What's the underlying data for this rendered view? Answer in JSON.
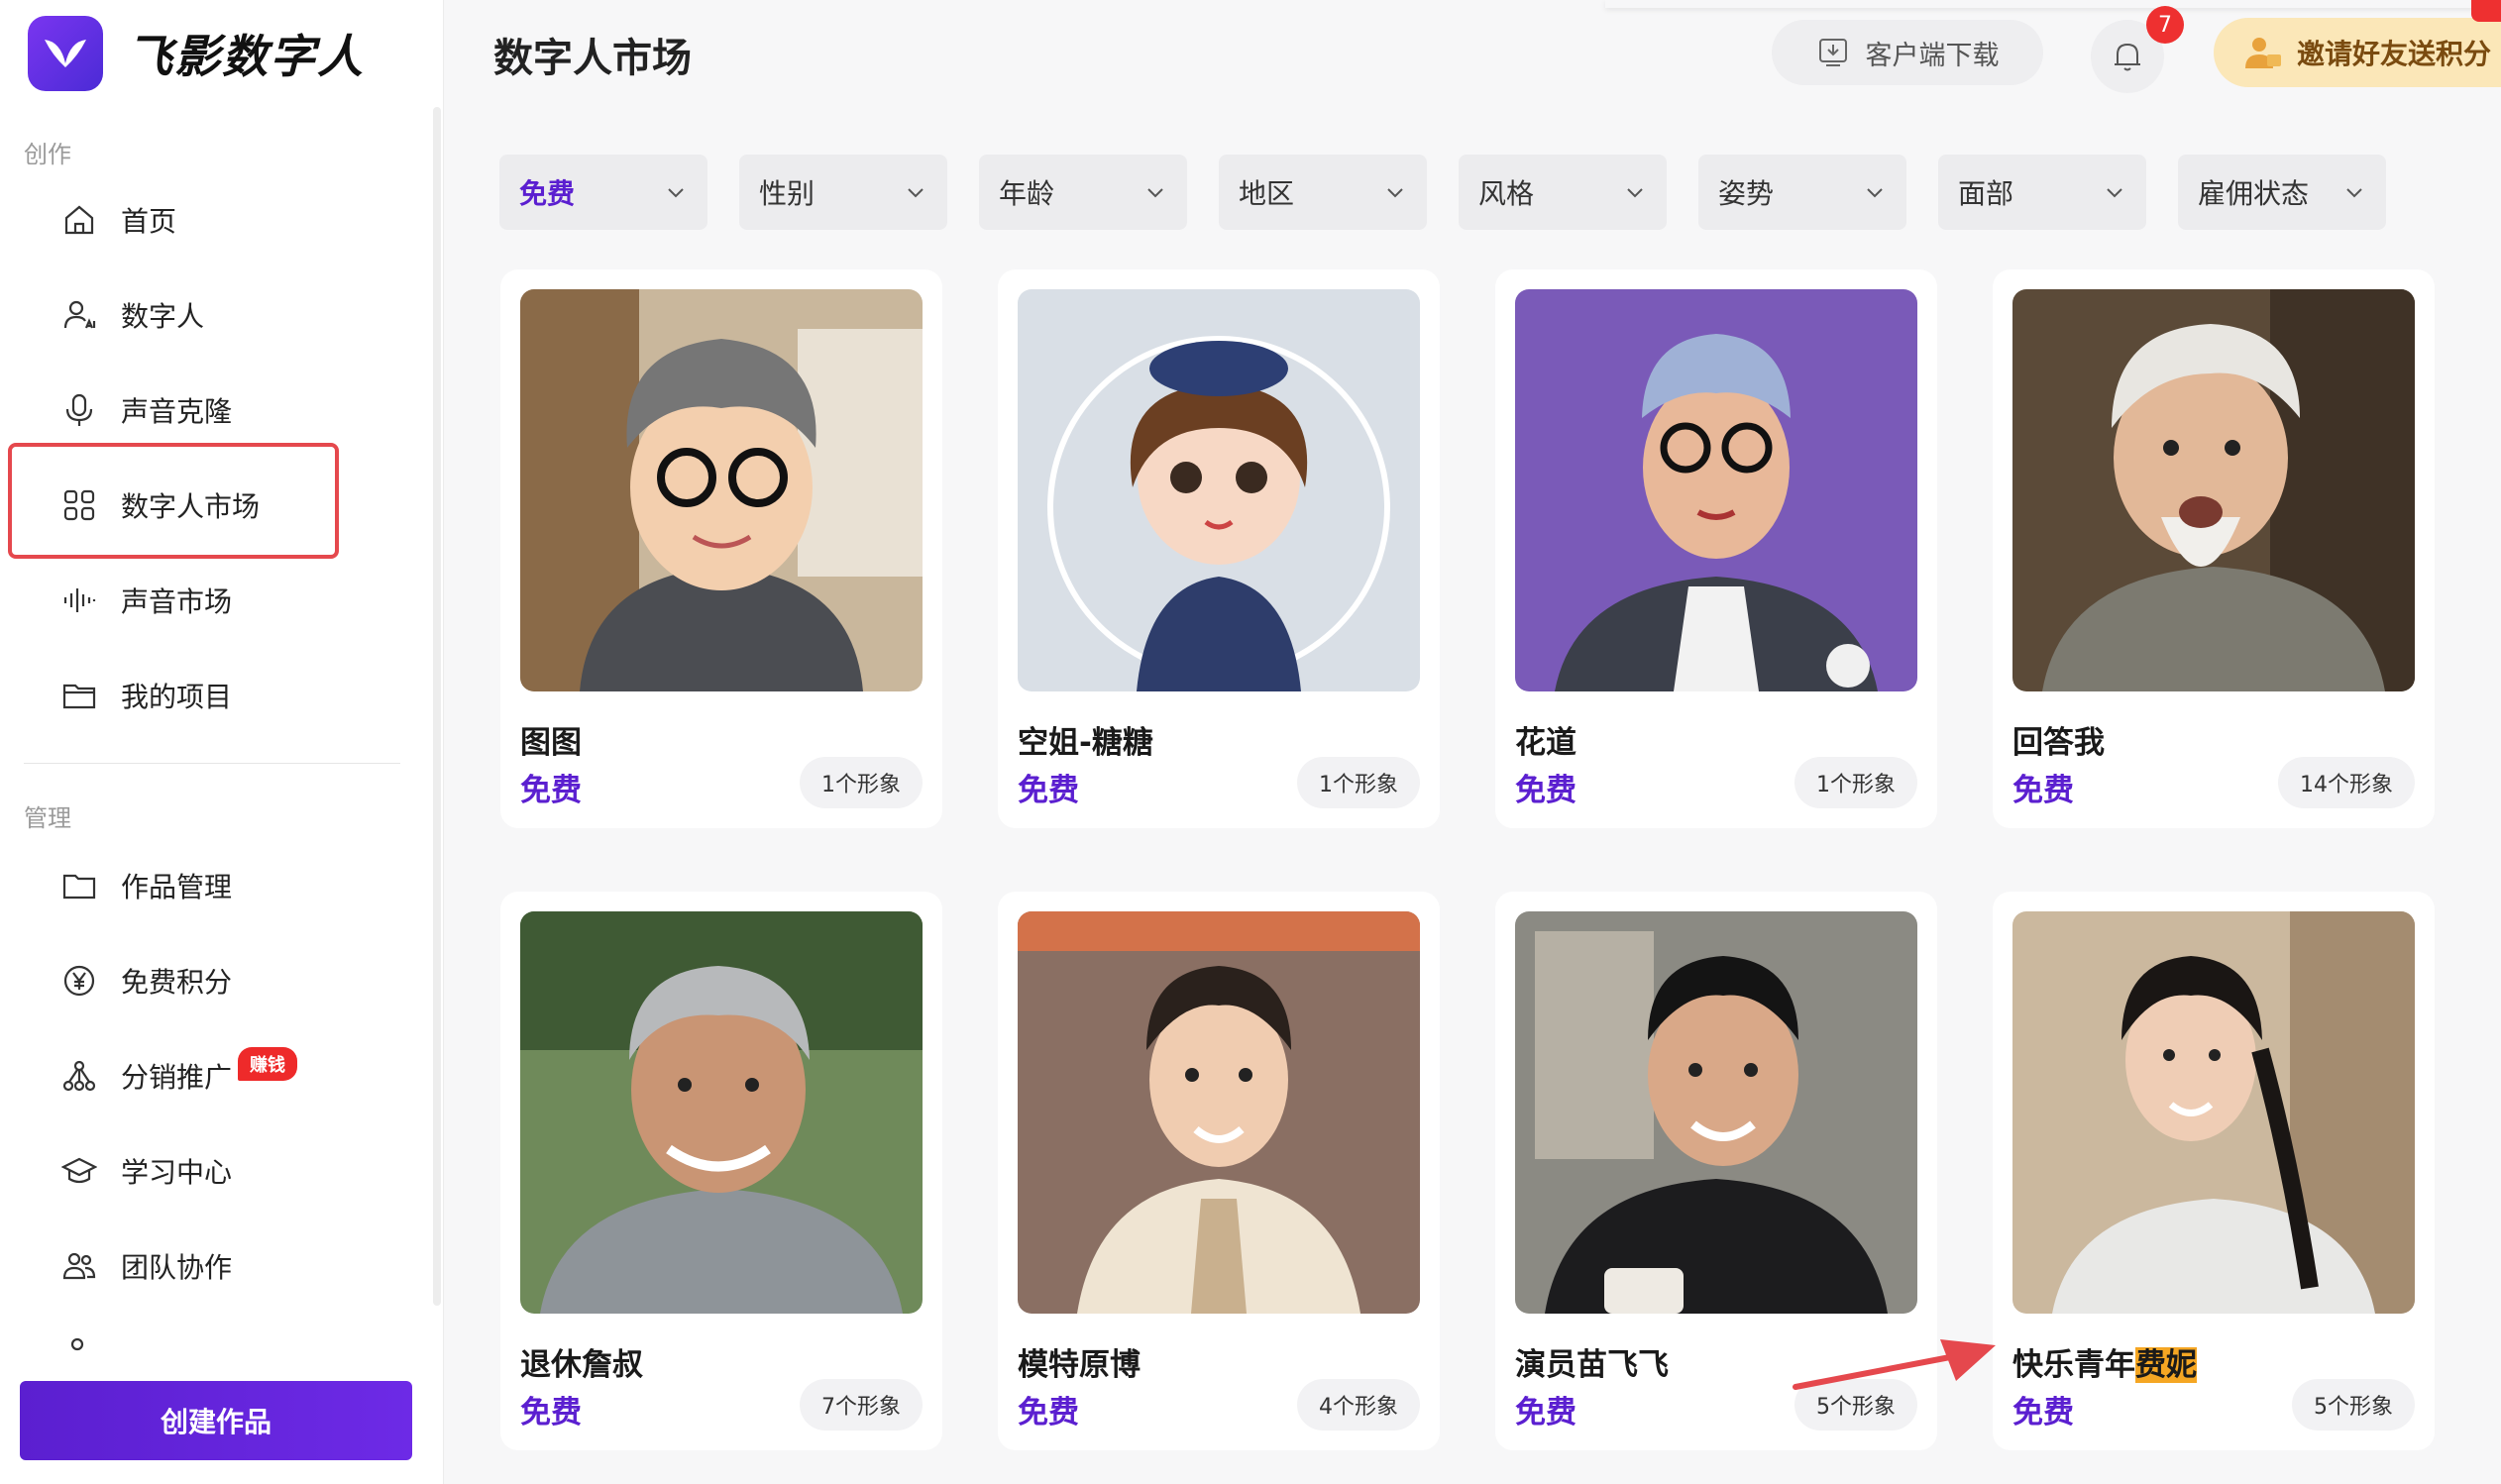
{
  "app": {
    "name": "飞影数字人"
  },
  "sidebar": {
    "section_create": "创作",
    "section_manage": "管理",
    "create_items": [
      {
        "label": "首页",
        "icon": "home-icon"
      },
      {
        "label": "数字人",
        "icon": "user-ai-icon"
      },
      {
        "label": "声音克隆",
        "icon": "microphone-icon"
      },
      {
        "label": "数字人市场",
        "icon": "grid-icon"
      },
      {
        "label": "声音市场",
        "icon": "waveform-icon"
      },
      {
        "label": "我的项目",
        "icon": "folder-icon"
      }
    ],
    "manage_items": [
      {
        "label": "作品管理",
        "icon": "folder-outline-icon"
      },
      {
        "label": "免费积分",
        "icon": "yen-coin-icon"
      },
      {
        "label": "分销推广",
        "icon": "network-icon"
      },
      {
        "label": "学习中心",
        "icon": "graduation-cap-icon"
      },
      {
        "label": "团队协作",
        "icon": "team-icon"
      }
    ],
    "earn_badge": "赚钱",
    "create_button": "创建作品"
  },
  "header": {
    "title": "数字人市场",
    "download_label": "客户端下载",
    "notification_count": "7",
    "invite_label": "邀请好友送积分"
  },
  "filters": [
    {
      "label": "免费",
      "active": true
    },
    {
      "label": "性别",
      "active": false
    },
    {
      "label": "年龄",
      "active": false
    },
    {
      "label": "地区",
      "active": false
    },
    {
      "label": "风格",
      "active": false
    },
    {
      "label": "姿势",
      "active": false
    },
    {
      "label": "面部",
      "active": false
    },
    {
      "label": "雇佣状态",
      "active": false
    }
  ],
  "cards": [
    {
      "name": "图图",
      "price": "免费",
      "count": "1个形象"
    },
    {
      "name": "空姐-糖糖",
      "price": "免费",
      "count": "1个形象"
    },
    {
      "name": "花道",
      "price": "免费",
      "count": "1个形象"
    },
    {
      "name": "回答我",
      "price": "免费",
      "count": "14个形象"
    },
    {
      "name": "退休詹叔",
      "price": "免费",
      "count": "7个形象"
    },
    {
      "name": "模特原博",
      "price": "免费",
      "count": "4个形象"
    },
    {
      "name": "演员苗飞飞",
      "price": "免费",
      "count": "5个形象"
    },
    {
      "name_prefix": "快乐青年",
      "name_highlight": "费妮",
      "price": "免费",
      "count": "5个形象"
    }
  ],
  "colors": {
    "accent": "#5b1fd0",
    "highlight_box": "#e5484d",
    "annotation_arrow": "#e5484d",
    "name_highlight": "#f5a623"
  }
}
